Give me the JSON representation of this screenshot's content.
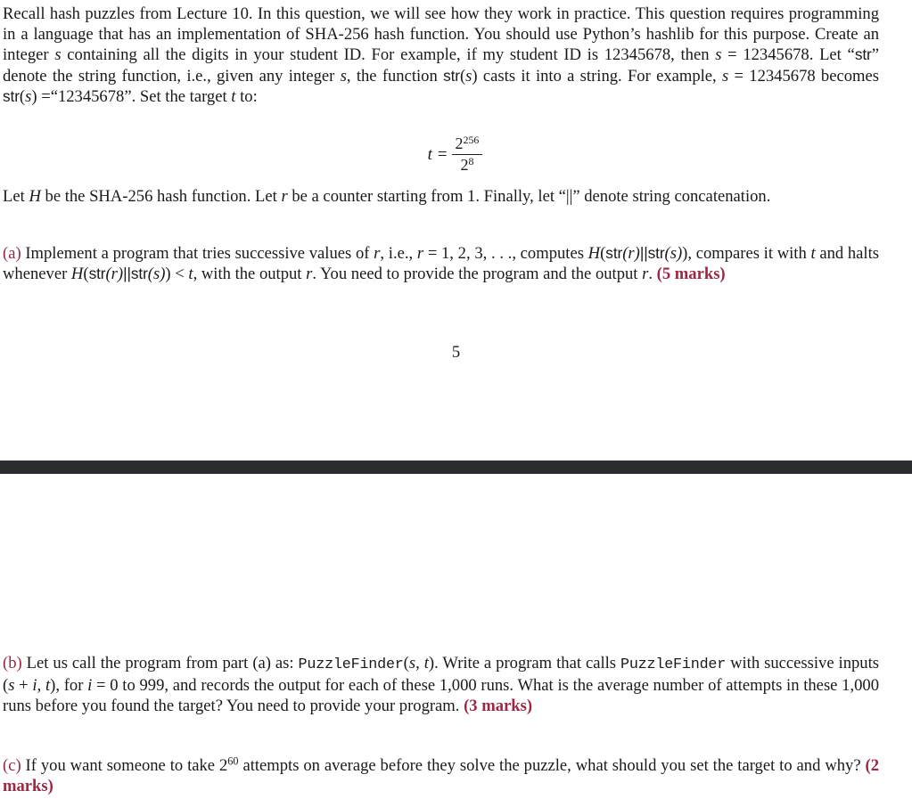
{
  "document": {
    "body_color": "#1a1a1a",
    "accent_color": "#9c2743",
    "separator_color": "#2b2c30",
    "background": "#ffffff"
  },
  "intro": {
    "seg1": "Recall hash puzzles from Lecture 10. In this question, we will see how they work in practice. This question requires programming in a language that has an implementation of SHA-256 hash function. You should use Python’s hashlib for this purpose. Create an integer ",
    "var_s_1": "s",
    "seg2": " containing all the digits in your student ID. For example, if my student ID is 12345678, then ",
    "var_s_2": "s",
    "eq_1": " = 12345678. Let “",
    "str_1": "str",
    "seg3": "” denote the string function, i.e., given any integer ",
    "var_s_3": "s",
    "seg4": ", the function ",
    "str_2": "str",
    "open_s": "(",
    "var_s_4": "s",
    "close_s": ")",
    "seg5": " casts it into a string. For example, ",
    "var_s_5": "s",
    "seg6": " = 12345678 becomes ",
    "str_3": "str",
    "open_s2": "(",
    "var_s_6": "s",
    "close_s2": ")",
    "seg7": " =“12345678”.",
    "seg8": " Set the target ",
    "var_t": "t",
    "seg9": " to:"
  },
  "equation": {
    "lhs": "t =",
    "numerator_base": "2",
    "numerator_exp": "256",
    "denominator_base": "2",
    "denominator_exp": "8"
  },
  "definitions": {
    "seg1": "Let ",
    "var_H": "H",
    "seg2": " be the SHA-256 hash function. Let ",
    "var_r": "r",
    "seg3": " be a counter starting from 1. Finally, let “||” denote string concatenation."
  },
  "part_a": {
    "label": "(a)",
    "seg1": " Implement a program that tries successive values of ",
    "var_r_1": "r",
    "seg2": ", i.e., ",
    "var_r_2": "r",
    "seg3": " = 1, 2, 3, . . ., computes ",
    "var_H_1": "H",
    "hash_open_1": "(",
    "str_r_1": "str",
    "r_arg_1": "(r)",
    "concat_1": "||",
    "str_s_1": "str",
    "s_arg_1": "(s)",
    "hash_close_1": ")",
    "seg4": ", compares it with ",
    "var_t_1": "t",
    "seg5": " and halts whenever ",
    "var_H_2": "H",
    "hash_open_2": "(",
    "str_r_2": "str",
    "r_arg_2": "(r)",
    "concat_2": "||",
    "str_s_2": "str",
    "s_arg_2": "(s)",
    "hash_close_2": ")",
    "seg6": " < ",
    "var_t_2": "t",
    "seg7": ", with the output ",
    "var_r_3": "r",
    "seg8": ". You need to provide the program and the output ",
    "var_r_4": "r",
    "seg9": ". ",
    "marks": "(5 marks)"
  },
  "page_number": "5",
  "part_b": {
    "label": "(b)",
    "seg1": " Let us call the program from part (a) as: ",
    "func_1": "PuzzleFinder",
    "args_open_1": "(",
    "arg_s_1": "s",
    "arg_comma_1": ", ",
    "arg_t_1": "t",
    "args_close_1": ")",
    "seg2": ". Write a program that calls ",
    "func_2": "PuzzleFinder",
    "seg3": " with successive inputs ",
    "args_open_2": "(",
    "arg_s_2": "s",
    "arg_plus": " + ",
    "arg_i_1": "i",
    "arg_comma_2": ", ",
    "arg_t_2": "t",
    "args_close_2": ")",
    "seg4": ", for ",
    "var_i": "i",
    "seg5": " = 0 to 999, and records the output for each of these 1,000 runs. What is the average number of attempts in these 1,000 runs before you found the target? You need to provide your program. ",
    "marks": "(3 marks)"
  },
  "part_c": {
    "label": "(c)",
    "seg1": " If you want someone to take 2",
    "exponent": "60",
    "seg2": " attempts on average before they solve the puzzle, what should you set the target to and why? ",
    "marks": "(2 marks)"
  }
}
